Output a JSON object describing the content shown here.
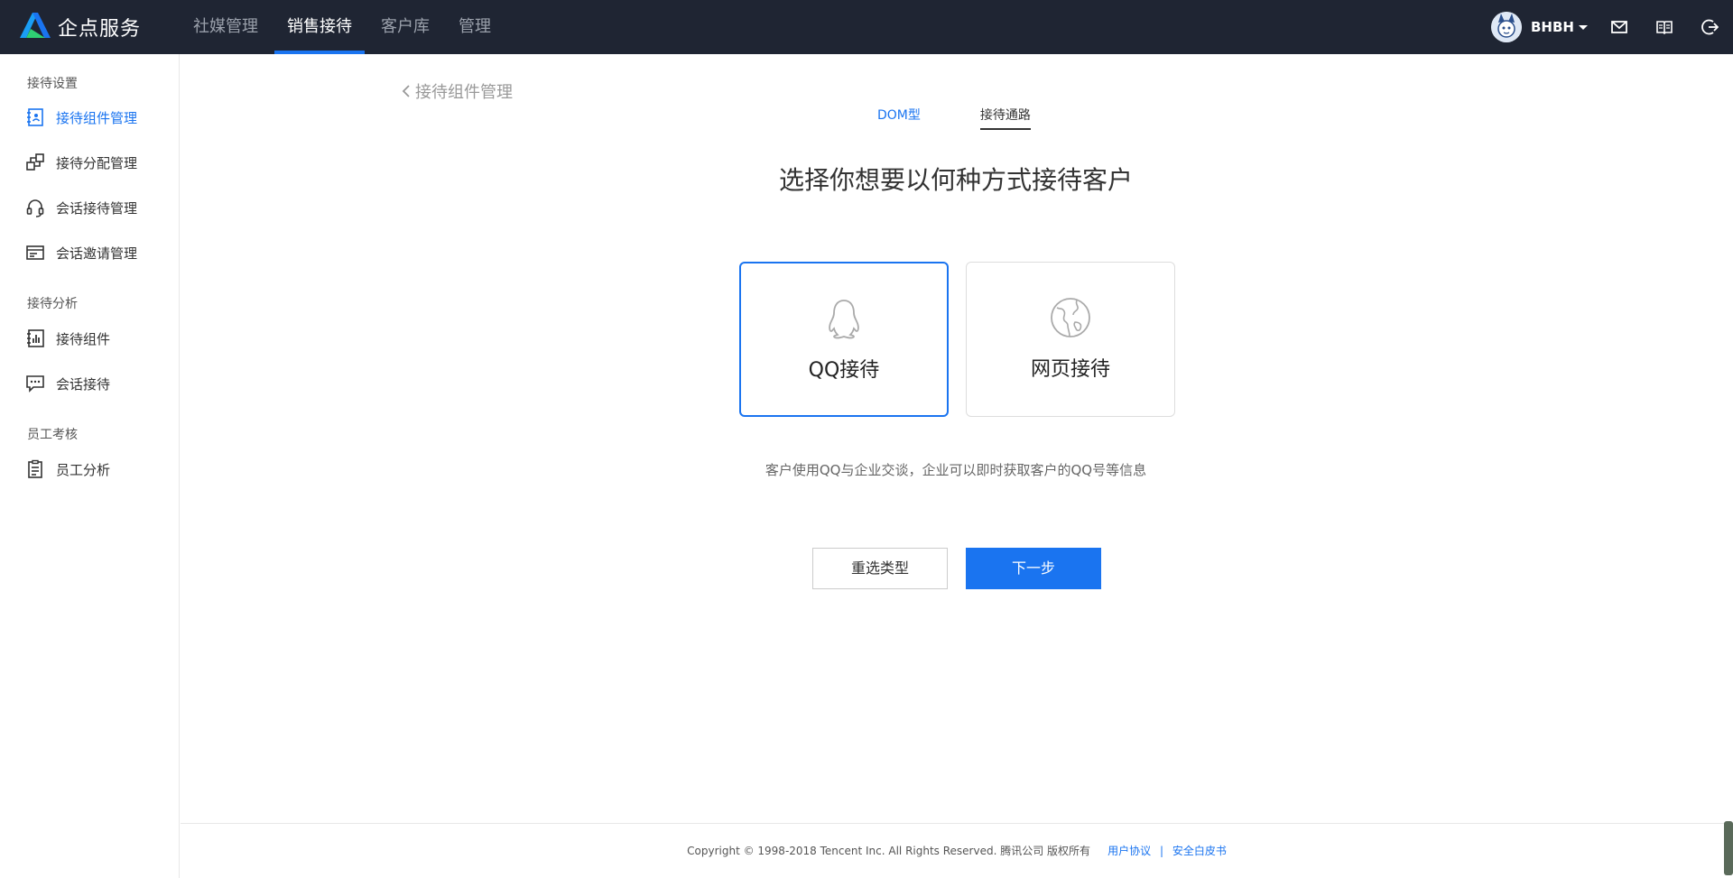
{
  "header": {
    "logo_text": "企点服务",
    "nav": [
      "社媒管理",
      "销售接待",
      "客户库",
      "管理"
    ],
    "active_nav": "销售接待",
    "username": "BHBH",
    "icons": [
      "mail-icon",
      "book-icon",
      "logout-icon"
    ]
  },
  "sidebar": {
    "groups": [
      {
        "title": "接待设置",
        "items": [
          {
            "label": "接待组件管理",
            "icon": "widget-icon",
            "active": true
          },
          {
            "label": "接待分配管理",
            "icon": "distribution-icon"
          },
          {
            "label": "会话接待管理",
            "icon": "headset-icon"
          },
          {
            "label": "会话邀请管理",
            "icon": "invite-icon"
          }
        ]
      },
      {
        "title": "接待分析",
        "items": [
          {
            "label": "接待组件",
            "icon": "chart-icon"
          },
          {
            "label": "会话接待",
            "icon": "chat-icon"
          }
        ]
      },
      {
        "title": "员工考核",
        "items": [
          {
            "label": "员工分析",
            "icon": "clipboard-icon"
          }
        ]
      }
    ]
  },
  "main": {
    "back_label": "接待组件管理",
    "tabs": [
      "DOM型",
      "接待通路"
    ],
    "title": "选择你想要以何种方式接待客户",
    "options": [
      {
        "label": "QQ接待",
        "icon": "qq-penguin-icon",
        "selected": true
      },
      {
        "label": "网页接待",
        "icon": "globe-icon",
        "selected": false
      }
    ],
    "description": "客户使用QQ与企业交谈，企业可以即时获取客户的QQ号等信息",
    "buttons": {
      "reset": "重选类型",
      "next": "下一步"
    }
  },
  "footer": {
    "copyright": "Copyright © 1998-2018 Tencent Inc. All Rights Reserved. 腾讯公司 版权所有",
    "links": [
      "用户协议",
      "安全白皮书"
    ],
    "separator": "|"
  },
  "colors": {
    "topbar": "#1f2533",
    "accent": "#1a74f0"
  }
}
